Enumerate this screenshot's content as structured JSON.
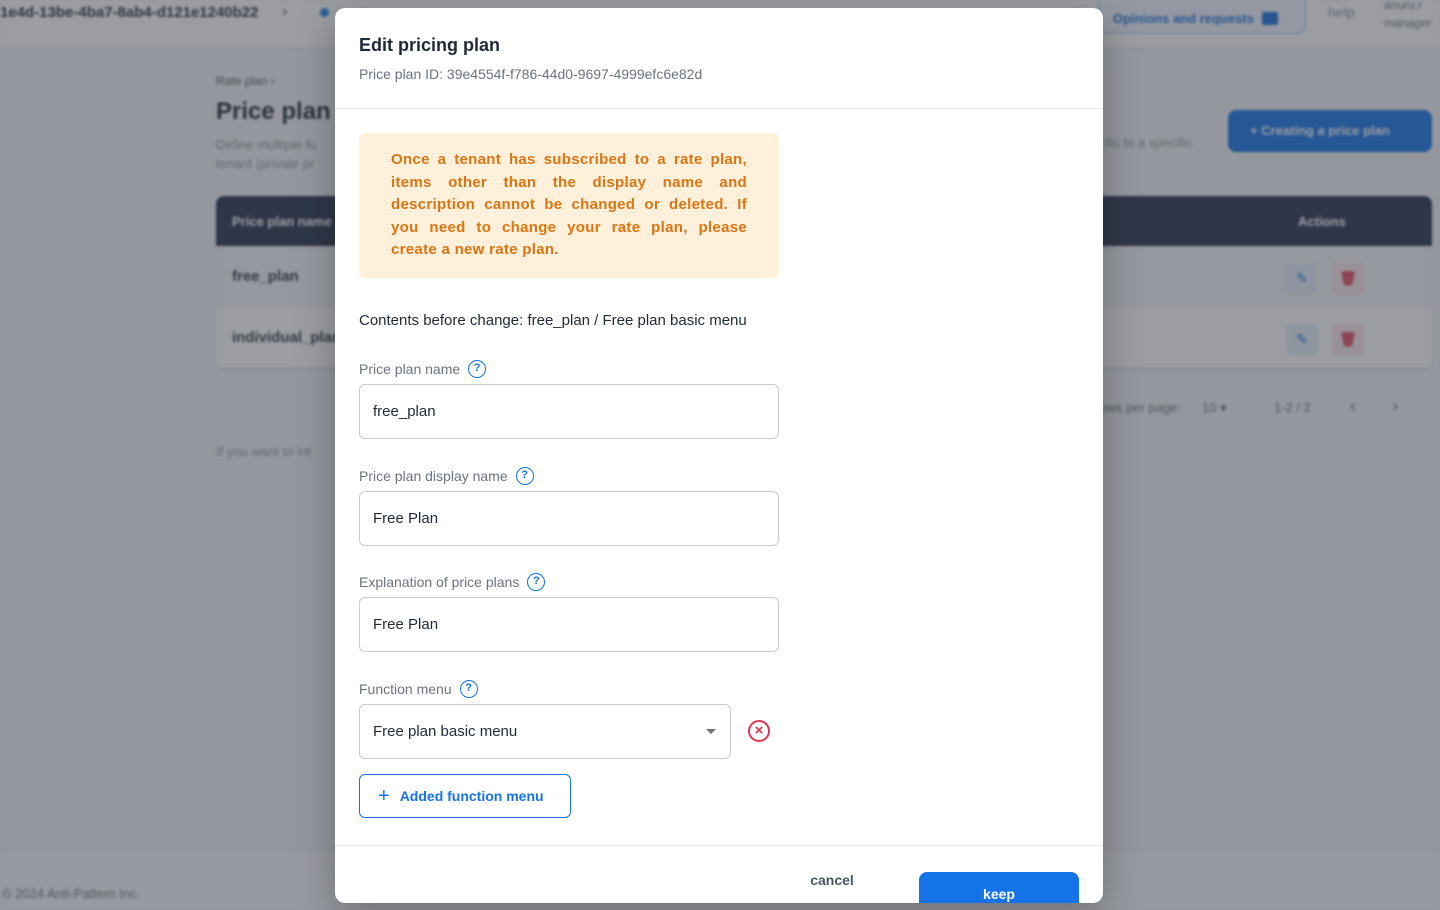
{
  "background": {
    "topbar": {
      "tenant_id": "1e4d-13be-4ba7-8ab4-d121e1240b22",
      "chevron": "›",
      "opinions_label": "Opinions and requests",
      "help_label": "help",
      "user_label": "anuru.r",
      "user_role": "manager"
    },
    "breadcrumb": "Rate plan  ›",
    "page_title": "Price plan",
    "page_desc_line1": "Define multiple fu",
    "page_desc_line2": "tenant (private pr",
    "page_desc_right": "ific to a specific",
    "create_button": "+ Creating a price plan",
    "table": {
      "header_name": "Price plan name",
      "header_actions": "Actions",
      "rows": [
        {
          "name": "free_plan"
        },
        {
          "name": "individual_plan"
        }
      ],
      "edit_icon": "✎",
      "delete_icon": "🗑"
    },
    "pager": {
      "rows_per_page_label": "Rows per page:",
      "rows_per_page_value": "10 ▾",
      "range": "1-2 / 2",
      "prev": "‹",
      "next": "›"
    },
    "footer_note": "If you want to int",
    "copyright": "© 2024 Anti-Pattern Inc."
  },
  "modal": {
    "title": "Edit pricing plan",
    "subtitle": "Price plan ID: 39e4554f-f786-44d0-9697-4999efc6e82d",
    "warning": "Once a tenant has subscribed to a rate plan, items other than the display name and description cannot be changed or deleted. If you need to change your rate plan, please create a new rate plan.",
    "contents_before_change": "Contents before change: free_plan / Free plan basic menu",
    "help_glyph": "?",
    "fields": {
      "plan_name": {
        "label": "Price plan name",
        "value": "free_plan"
      },
      "display_name": {
        "label": "Price plan display name",
        "value": "Free Plan"
      },
      "explanation": {
        "label": "Explanation of price plans",
        "value": "Free Plan"
      },
      "function_menu": {
        "label": "Function menu",
        "value": "Free plan basic menu"
      }
    },
    "remove_glyph": "×",
    "add_function_menu": {
      "plus": "+",
      "label": "Added function menu"
    },
    "cancel_label": "cancel",
    "keep_label": "keep"
  },
  "colors": {
    "primary": "#1473e6",
    "warning_bg": "#fff0db",
    "warning_text": "#d97512",
    "danger": "#e0364f",
    "table_header": "#25324d"
  }
}
